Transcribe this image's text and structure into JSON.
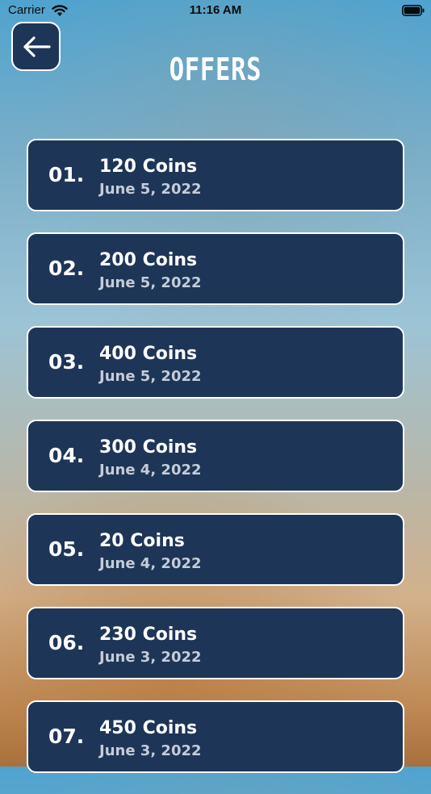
{
  "status_bar": {
    "carrier": "Carrier",
    "time": "11:16 AM",
    "icons": [
      "wifi-icon",
      "battery-icon"
    ]
  },
  "header": {
    "back_icon": "arrow-left-icon",
    "title": "OFFERS"
  },
  "colors": {
    "card_bg": "#1d3557",
    "card_border": "#ffffff",
    "date_text": "#c5ccd8"
  },
  "offers": [
    {
      "number": "01.",
      "title": "120 Coins",
      "date": "June 5, 2022"
    },
    {
      "number": "02.",
      "title": "200 Coins",
      "date": "June 5, 2022"
    },
    {
      "number": "03.",
      "title": "400 Coins",
      "date": "June 5, 2022"
    },
    {
      "number": "04.",
      "title": "300 Coins",
      "date": "June 4, 2022"
    },
    {
      "number": "05.",
      "title": "20 Coins",
      "date": "June 4, 2022"
    },
    {
      "number": "06.",
      "title": "230 Coins",
      "date": "June 3, 2022"
    },
    {
      "number": "07.",
      "title": "450 Coins",
      "date": "June 3, 2022"
    }
  ]
}
